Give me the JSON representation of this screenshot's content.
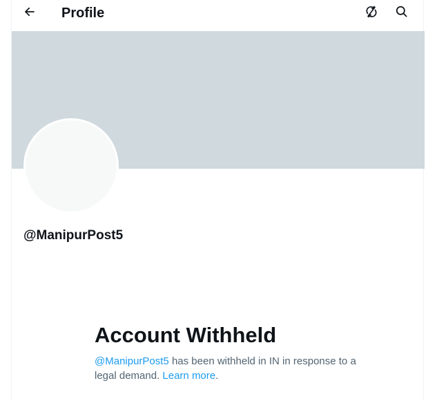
{
  "header": {
    "title": "Profile",
    "back_icon": "arrow-left-icon",
    "refresh_icon": "refresh-off-icon",
    "search_icon": "search-icon"
  },
  "profile": {
    "handle": "@ManipurPost5",
    "banner_color": "#cfd9de",
    "avatar_color": "#f7f9f9"
  },
  "withheld_notice": {
    "title": "Account Withheld",
    "handle_link": "@ManipurPost5",
    "text_middle": " has been withheld in IN in response to a legal demand. ",
    "learn_more": "Learn more",
    "text_end": "."
  },
  "colors": {
    "accent": "#1d9bf0",
    "text_primary": "#0f1419",
    "text_secondary": "#536471"
  }
}
